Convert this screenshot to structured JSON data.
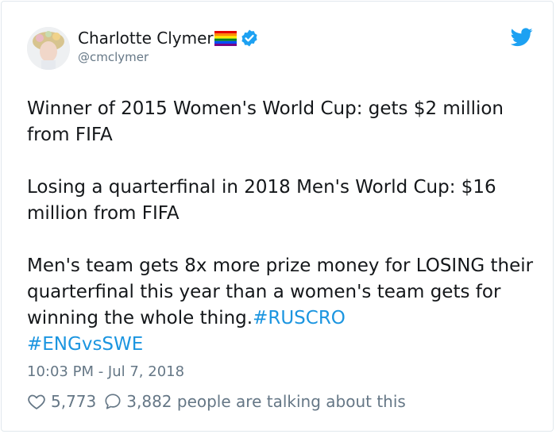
{
  "user": {
    "display_name": "Charlotte Clymer",
    "handle": "@cmclymer",
    "flag_icon": "rainbow-flag-icon",
    "verified_icon": "verified-badge-icon"
  },
  "brand": {
    "icon": "twitter-bird-icon",
    "color": "#1da1f2"
  },
  "tweet": {
    "para1": "Winner of 2015 Women's World Cup: gets $2 million from FIFA",
    "para2": "Losing a quarterfinal in 2018 Men's World Cup: $16 million from FIFA",
    "para3": "Men's team gets 8x more prize money for LOSING their quarterfinal this year than a women's team gets for winning the whole thing.",
    "hashtags": [
      "#RUSCRO",
      "#ENGvsSWE"
    ],
    "timestamp": "10:03 PM - Jul 7, 2018"
  },
  "engagement": {
    "likes": "5,773",
    "talking": "3,882 people are talking about this"
  },
  "colors": {
    "text": "#14171a",
    "muted": "#657786",
    "link": "#1b95e0",
    "border": "#e1e8ed"
  }
}
